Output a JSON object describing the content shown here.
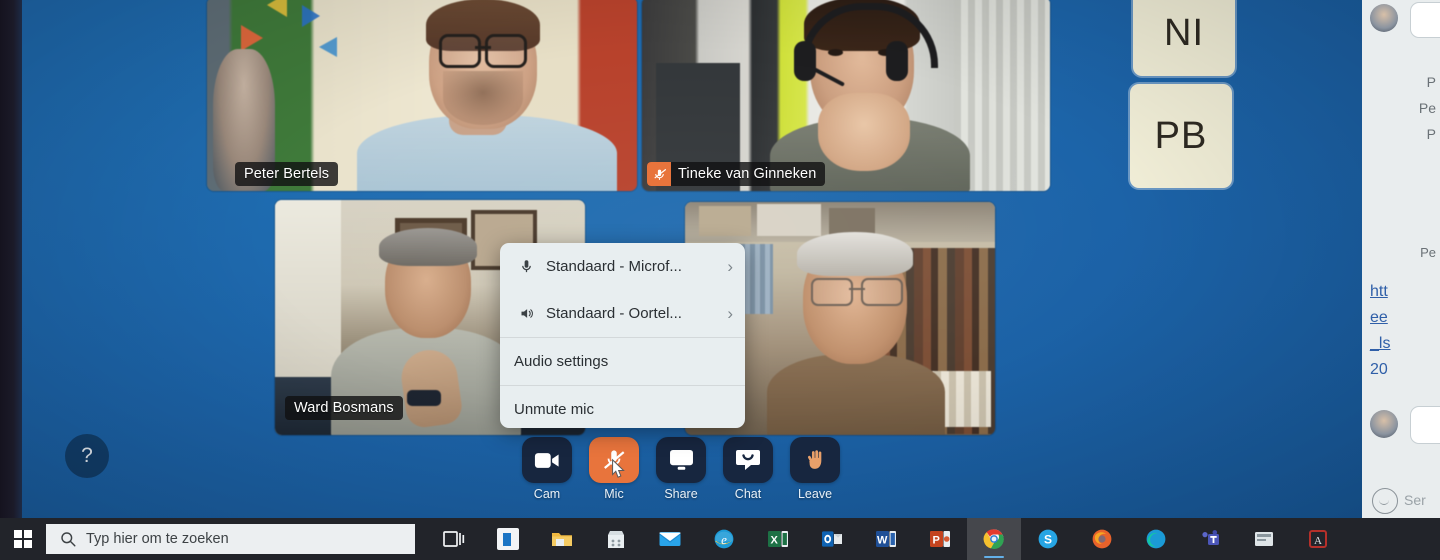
{
  "meeting": {
    "participants": [
      {
        "name": "Peter Bertels",
        "muted": false
      },
      {
        "name": "Tineke van Ginneken",
        "muted": true
      },
      {
        "name": "Ward Bosmans",
        "muted": false
      },
      {
        "name": "",
        "muted": false
      }
    ],
    "initials_tiles": [
      {
        "initials": "NI"
      },
      {
        "initials": "PB"
      }
    ],
    "help_button": "?",
    "background_color": "#1c63a8"
  },
  "audio_menu": {
    "items": [
      {
        "icon": "microphone-icon",
        "label": "Standaard - Microf...",
        "chevron": "›"
      },
      {
        "icon": "speaker-icon",
        "label": "Standaard - Oortel...",
        "chevron": "›"
      },
      {
        "icon": "",
        "label": "Audio settings",
        "chevron": ""
      },
      {
        "icon": "",
        "label": "Unmute mic",
        "chevron": ""
      }
    ]
  },
  "controls": [
    {
      "label": "Cam",
      "icon": "camera-icon",
      "active": false,
      "accent": "#17263f"
    },
    {
      "label": "Mic",
      "icon": "mic-muted-icon",
      "active": true,
      "accent": "#e8743c"
    },
    {
      "label": "Share",
      "icon": "screen-share-icon",
      "active": false,
      "accent": "#17263f"
    },
    {
      "label": "Chat",
      "icon": "chat-icon",
      "active": false,
      "accent": "#17263f"
    },
    {
      "label": "Leave",
      "icon": "raised-hand-icon",
      "active": false,
      "accent": "#17263f"
    }
  ],
  "chat_panel": {
    "message_fragments": [
      "P",
      "Pe",
      "P"
    ],
    "sender_fragment": "Pe",
    "link_fragments": [
      "htt",
      "ee",
      "_ls",
      "20"
    ],
    "send_placeholder": "Ser"
  },
  "taskbar": {
    "search_placeholder": "Typ hier om te zoeken",
    "start_icon": "windows-logo-icon",
    "search_icon": "search-icon",
    "items": [
      {
        "name": "task-view-icon",
        "label": "Taakweergave"
      },
      {
        "name": "cortana-icon",
        "label": "Cortana"
      },
      {
        "name": "file-explorer-icon",
        "label": "Verkenner"
      },
      {
        "name": "microsoft-store-icon",
        "label": "Microsoft Store"
      },
      {
        "name": "mail-icon",
        "label": "Mail"
      },
      {
        "name": "internet-explorer-icon",
        "label": "Internet Explorer"
      },
      {
        "name": "excel-icon",
        "label": "Excel"
      },
      {
        "name": "outlook-icon",
        "label": "Outlook"
      },
      {
        "name": "word-icon",
        "label": "Word"
      },
      {
        "name": "powerpoint-icon",
        "label": "PowerPoint"
      },
      {
        "name": "chrome-icon",
        "label": "Google Chrome"
      },
      {
        "name": "skype-icon",
        "label": "Skype"
      },
      {
        "name": "firefox-icon",
        "label": "Firefox"
      },
      {
        "name": "edge-icon",
        "label": "Microsoft Edge"
      },
      {
        "name": "teams-icon",
        "label": "Microsoft Teams"
      },
      {
        "name": "app-icon",
        "label": "App"
      },
      {
        "name": "acrobat-icon",
        "label": "Acrobat"
      }
    ]
  }
}
